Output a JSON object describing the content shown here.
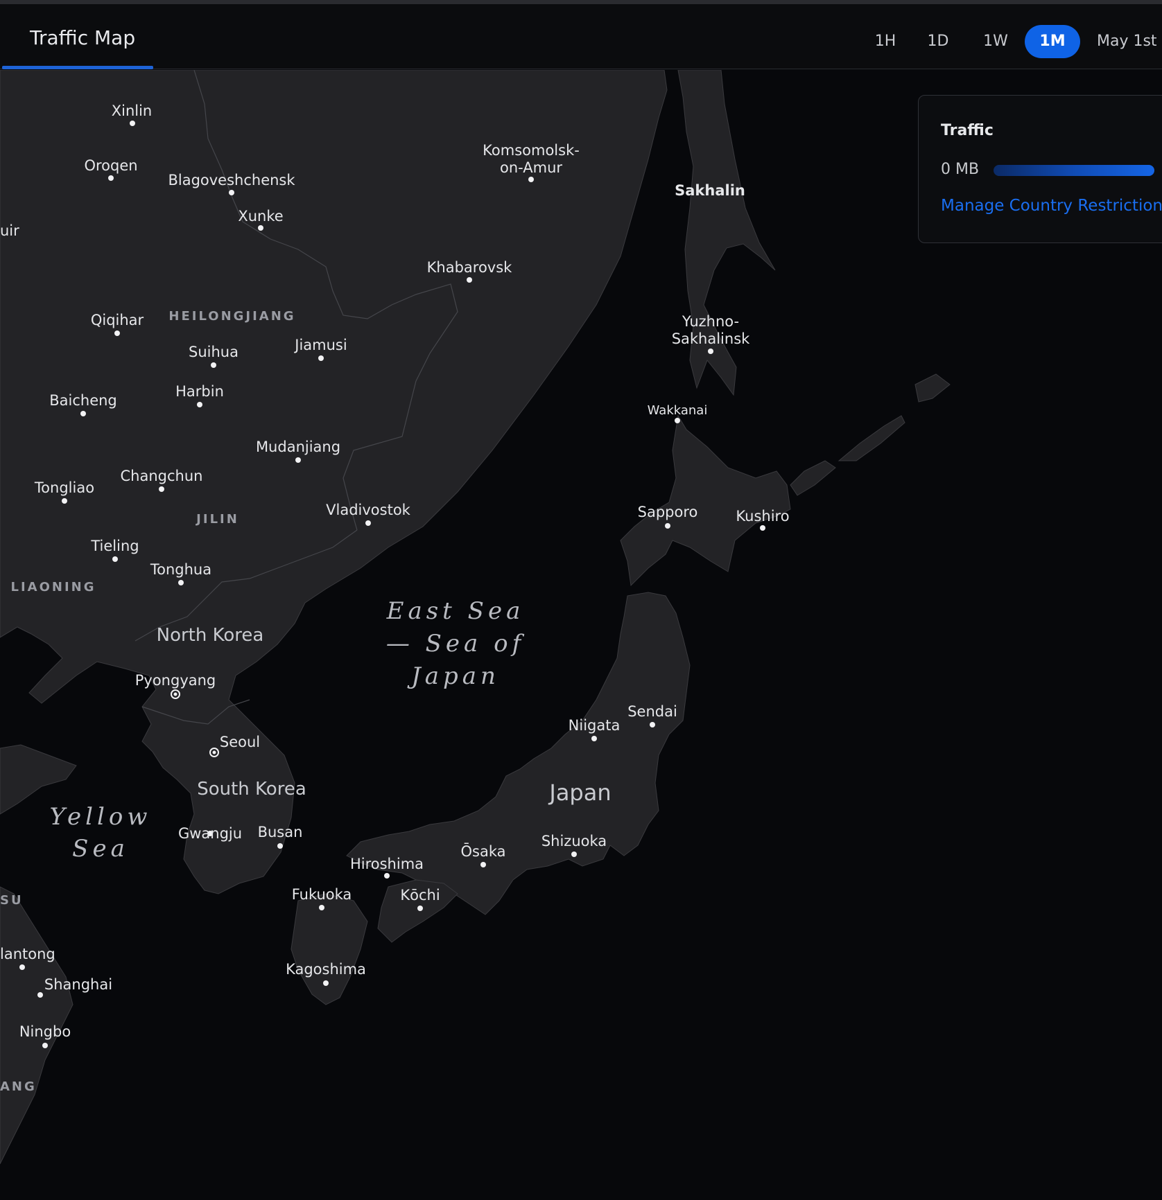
{
  "header": {
    "tab_title": "Traffic Map",
    "ranges": [
      "1H",
      "1D",
      "1W",
      "1M"
    ],
    "active_range": "1M",
    "date_label": "May 1st -"
  },
  "legend": {
    "title": "Traffic",
    "value": "0 MB",
    "link": "Manage Country Restrictions"
  },
  "map": {
    "cities": [
      "Xinlin",
      "Oroqen",
      "Blagoveshchensk",
      "Xunke",
      "Komsomolsk-",
      "on-Amur",
      "Khabarovsk",
      "Qiqihar",
      "Suihua",
      "Jiamusi",
      "Baicheng",
      "Harbin",
      "Mudanjiang",
      "Changchun",
      "Tongliao",
      "Vladivostok",
      "Tieling",
      "Tonghua",
      "Pyongyang",
      "Seoul",
      "Gwangju",
      "Busan",
      "Sakhalin",
      "Yuzhno-",
      "Sakhalinsk",
      "Wakkanai",
      "Sapporo",
      "Kushiro",
      "Sendai",
      "Niigata",
      "Shizuoka",
      "Ōsaka",
      "Hiroshima",
      "Kōchi",
      "Fukuoka",
      "Kagoshima",
      "Shanghai",
      "Ningbo",
      "lantong",
      "uir"
    ],
    "regions": [
      "HEILONGJIANG",
      "JILIN",
      "LIAONING",
      "SU",
      "ANG"
    ],
    "countries": [
      "North Korea",
      "South Korea",
      "Japan"
    ],
    "seas": [
      "East Sea",
      "— Sea of",
      "Japan",
      "Yellow",
      "Sea"
    ]
  }
}
